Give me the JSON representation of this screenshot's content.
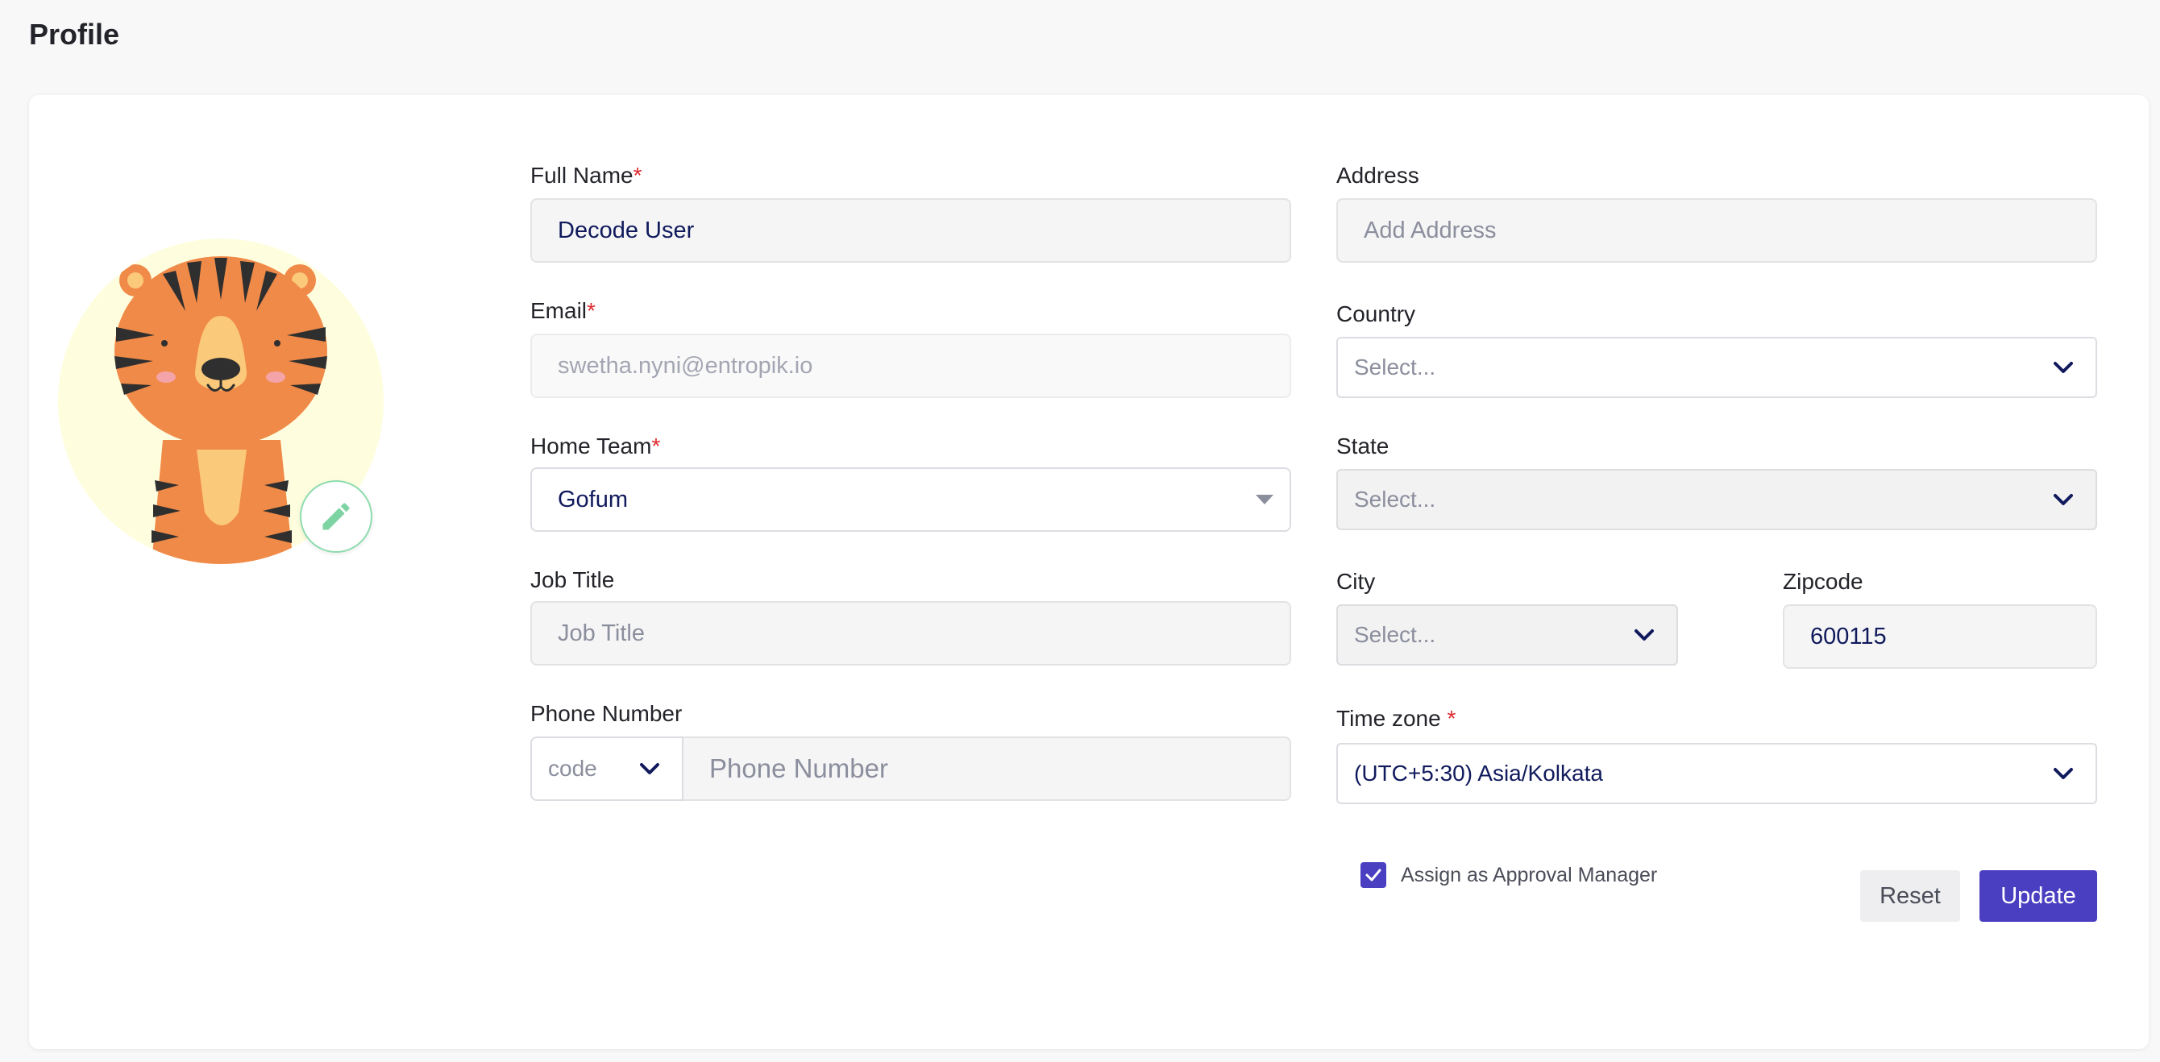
{
  "page": {
    "title": "Profile"
  },
  "form": {
    "full_name": {
      "label": "Full Name",
      "required": "*",
      "value": "Decode User"
    },
    "email": {
      "label": "Email",
      "required": "*",
      "value": "swetha.nyni@entropik.io"
    },
    "home_team": {
      "label": "Home Team",
      "required": "*",
      "value": "Gofum"
    },
    "job_title": {
      "label": "Job Title",
      "placeholder": "Job Title"
    },
    "phone": {
      "label": "Phone Number",
      "code_placeholder": "code",
      "placeholder": "Phone Number"
    },
    "address": {
      "label": "Address",
      "placeholder": "Add Address"
    },
    "country": {
      "label": "Country",
      "placeholder": "Select..."
    },
    "state": {
      "label": "State",
      "placeholder": "Select..."
    },
    "city": {
      "label": "City",
      "placeholder": "Select..."
    },
    "zipcode": {
      "label": "Zipcode",
      "value": "600115"
    },
    "timezone": {
      "label": "Time zone",
      "required": "*",
      "value": "(UTC+5:30) Asia/Kolkata"
    },
    "approval": {
      "label": "Assign as Approval Manager",
      "checked": true
    }
  },
  "actions": {
    "reset": "Reset",
    "update": "Update"
  },
  "icons": {
    "avatar": "tiger-avatar",
    "edit": "pencil-icon",
    "chevron": "chevron-down-icon",
    "caret": "caret-down-icon",
    "check": "check-icon"
  },
  "colors": {
    "primary": "#4a3fc1",
    "required": "#e0282e",
    "edit_accent": "#7dd4a2",
    "avatar_bg": "#fefedf"
  }
}
